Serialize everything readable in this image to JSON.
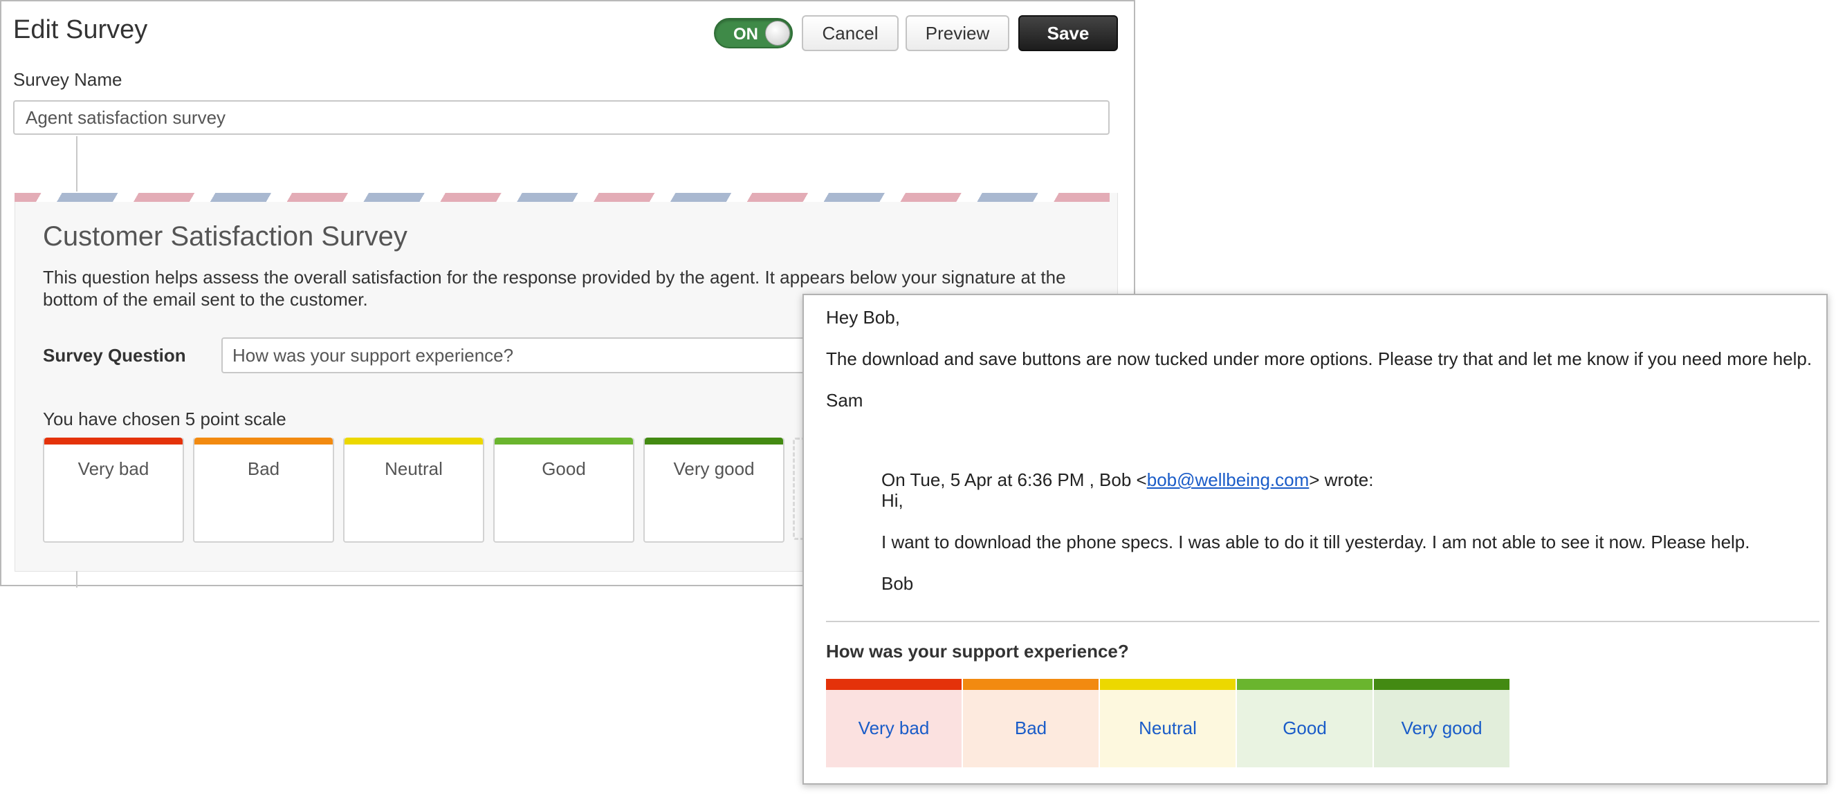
{
  "editor": {
    "title": "Edit Survey",
    "toggle_label": "ON",
    "buttons": {
      "cancel": "Cancel",
      "preview": "Preview",
      "save": "Save"
    },
    "survey_name_label": "Survey Name",
    "survey_name_value": "Agent satisfaction survey",
    "card": {
      "title": "Customer Satisfaction Survey",
      "description": "This question helps assess the overall satisfaction for the response provided by the agent. It appears below your signature at the bottom of the email sent to the customer.",
      "question_label": "Survey Question",
      "question_value": "How was your support experience?",
      "scale_label": "You have chosen 5 point scale",
      "scale": [
        {
          "label": "Very bad",
          "color": "#e4320a"
        },
        {
          "label": "Bad",
          "color": "#f28a10"
        },
        {
          "label": "Neutral",
          "color": "#ecd800"
        },
        {
          "label": "Good",
          "color": "#6ab52e"
        },
        {
          "label": "Very good",
          "color": "#438a12"
        }
      ]
    }
  },
  "email": {
    "greeting": "Hey Bob,",
    "body": "The download and save buttons are now tucked under more options. Please try that and let me know if you need more help.",
    "signature": "Sam",
    "quote": {
      "header_prefix": "On Tue, 5 Apr at 6:36 PM , Bob <",
      "header_email": "bob@wellbeing.com",
      "header_suffix": "> wrote:",
      "greeting": "Hi,",
      "body": "I want to download the phone specs. I was able to do it till yesterday. I am not able to see it now. Please help.",
      "signature": "Bob"
    },
    "survey_question": "How was your support experience?",
    "ratings": [
      {
        "label": "Very bad",
        "color": "#e4320a",
        "bg": "#fbe1e0"
      },
      {
        "label": "Bad",
        "color": "#f28a10",
        "bg": "#fdeade"
      },
      {
        "label": "Neutral",
        "color": "#ecd800",
        "bg": "#fdf8de"
      },
      {
        "label": "Good",
        "color": "#6ab52e",
        "bg": "#e9f3e1"
      },
      {
        "label": "Very good",
        "color": "#438a12",
        "bg": "#e2eedb"
      }
    ]
  }
}
